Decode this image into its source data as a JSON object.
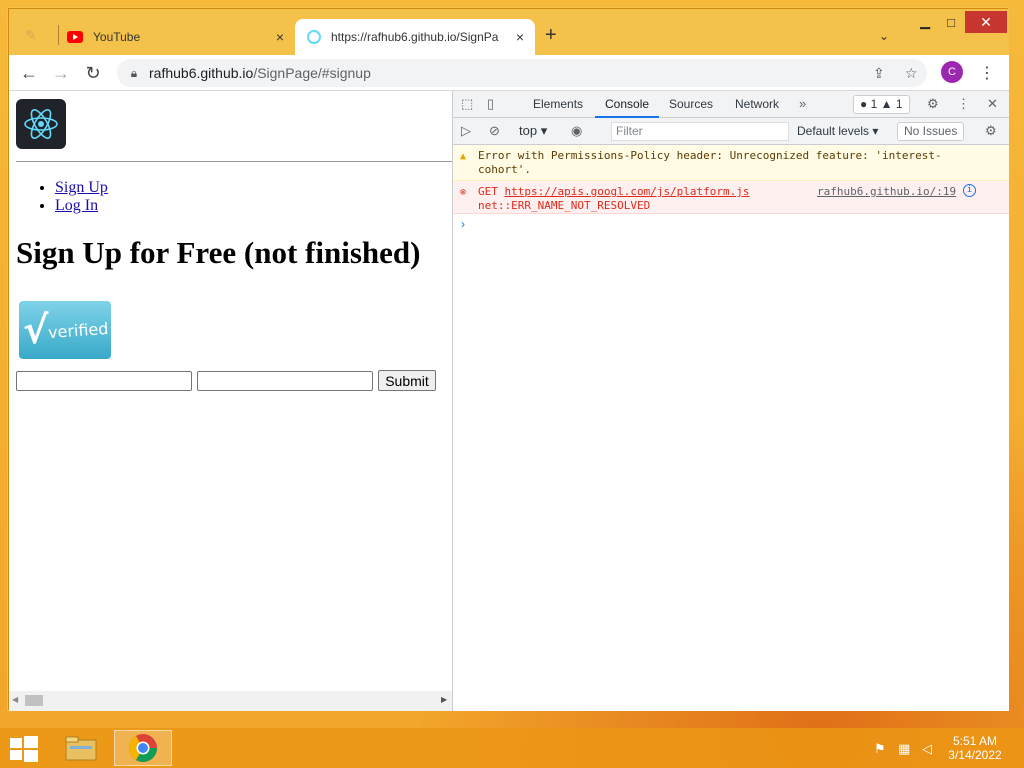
{
  "browser": {
    "tabs": [
      {
        "title": "",
        "state": "ghost"
      },
      {
        "title": "YouTube",
        "close": "×"
      },
      {
        "title": "https://rafhub6.github.io/SignPa",
        "close": "×"
      }
    ],
    "new_tab": "+",
    "tab_search": "⌄",
    "window_controls": {
      "minimize": "▁",
      "maximize": "□",
      "close": "✕"
    },
    "address": {
      "host": "rafhub6.github.io",
      "path": "/SignPage/#signup"
    },
    "profile_initial": "C",
    "menu": "⋮"
  },
  "page": {
    "nav": [
      "Sign Up",
      "Log In"
    ],
    "heading": "Sign Up for Free (not finished)",
    "verified_badge": {
      "check": "√",
      "word": "verified"
    },
    "form": {
      "field1_value": "",
      "field2_value": "",
      "submit_label": "Submit"
    }
  },
  "devtools": {
    "tabs": [
      "Elements",
      "Console",
      "Sources",
      "Network"
    ],
    "active_tab": "Console",
    "more": "»",
    "counts": {
      "errors": "1",
      "warnings": "1"
    },
    "context": "top",
    "filter_placeholder": "Filter",
    "levels": "Default levels",
    "issues": "No Issues",
    "messages": [
      {
        "level": "warning",
        "text": "Error with Permissions-Policy header: Unrecognized feature: 'interest-cohort'."
      },
      {
        "level": "error",
        "method": "GET",
        "url": "https://apis.googl.com/js/platform.js",
        "detail": "net::ERR_NAME_NOT_RESOLVED",
        "source": "rafhub6.github.io/:19"
      }
    ],
    "prompt": "›"
  },
  "taskbar": {
    "time": "5:51 AM",
    "date": "3/14/2022"
  },
  "colors": {
    "accent": "#1a73e8",
    "error": "#e2291b",
    "warning_bg": "#fffbe5",
    "titlebar": "#f4c24a",
    "close_red": "#c7372f",
    "react": "#61dafb"
  }
}
